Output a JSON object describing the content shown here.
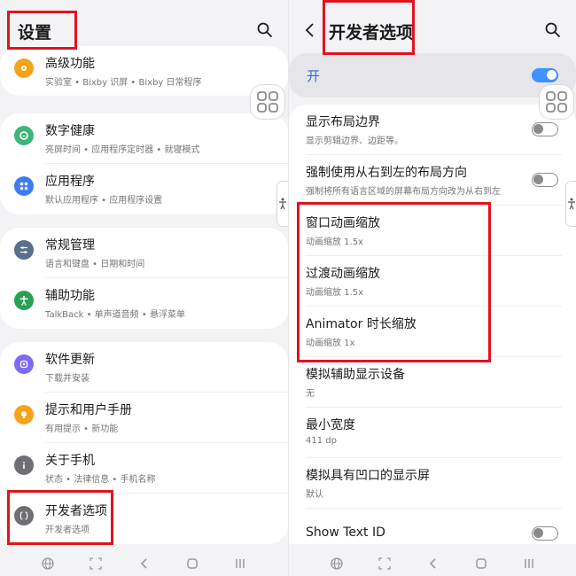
{
  "left": {
    "title": "设置",
    "groups": [
      [
        {
          "title": "高级功能",
          "sub": "实验室 • Bixby 识屏 • Bixby 日常程序",
          "icon": "advanced-features-icon",
          "color": "#f4a31a"
        }
      ],
      [
        {
          "title": "数字健康",
          "sub": "亮屏时间 • 应用程序定时器 • 就寝模式",
          "icon": "digital-wellbeing-icon",
          "color": "#3fb57a"
        },
        {
          "title": "应用程序",
          "sub": "默认应用程序 • 应用程序设置",
          "icon": "apps-icon",
          "color": "#3e7bf2"
        }
      ],
      [
        {
          "title": "常规管理",
          "sub": "语言和键盘 • 日期和时间",
          "icon": "general-management-icon",
          "color": "#5a6f8c"
        },
        {
          "title": "辅助功能",
          "sub": "TalkBack • 单声道音频 • 悬浮菜单",
          "icon": "accessibility-icon",
          "color": "#2aa053"
        }
      ],
      [
        {
          "title": "软件更新",
          "sub": "下载并安装",
          "icon": "software-update-icon",
          "color": "#7c6cf0"
        },
        {
          "title": "提示和用户手册",
          "sub": "有用提示 • 新功能",
          "icon": "tips-icon",
          "color": "#f4a31a"
        },
        {
          "title": "关于手机",
          "sub": "状态 • 法律信息 • 手机名称",
          "icon": "about-phone-icon",
          "color": "#6e6e73"
        },
        {
          "title": "开发者选项",
          "sub": "开发者选项",
          "icon": "developer-options-icon",
          "color": "#6e6e73"
        }
      ]
    ]
  },
  "right": {
    "title": "开发者选项",
    "master_label": "开",
    "master_on": true,
    "items": [
      {
        "title": "显示布局边界",
        "sub": "显示剪辑边界、边距等。",
        "toggle": false
      },
      {
        "title": "强制使用从右到左的布局方向",
        "sub": "强制将所有语言区域的屏幕布局方向改为从右到左",
        "toggle": false
      },
      {
        "title": "窗口动画缩放",
        "sub": "动画缩放 1.5x"
      },
      {
        "title": "过渡动画缩放",
        "sub": "动画缩放 1.5x"
      },
      {
        "title": "Animator 时长缩放",
        "sub": "动画缩放 1x"
      },
      {
        "title": "模拟辅助显示设备",
        "sub": "无"
      },
      {
        "title": "最小宽度",
        "sub": "411 dp"
      },
      {
        "title": "模拟具有凹口的显示屏",
        "sub": "默认"
      },
      {
        "title": "Show Text ID",
        "sub": "",
        "toggle": false
      }
    ]
  },
  "colors": {
    "highlight": "#e0141e",
    "toggle_on": "#3e91ff",
    "background": "#f3f3f5"
  }
}
